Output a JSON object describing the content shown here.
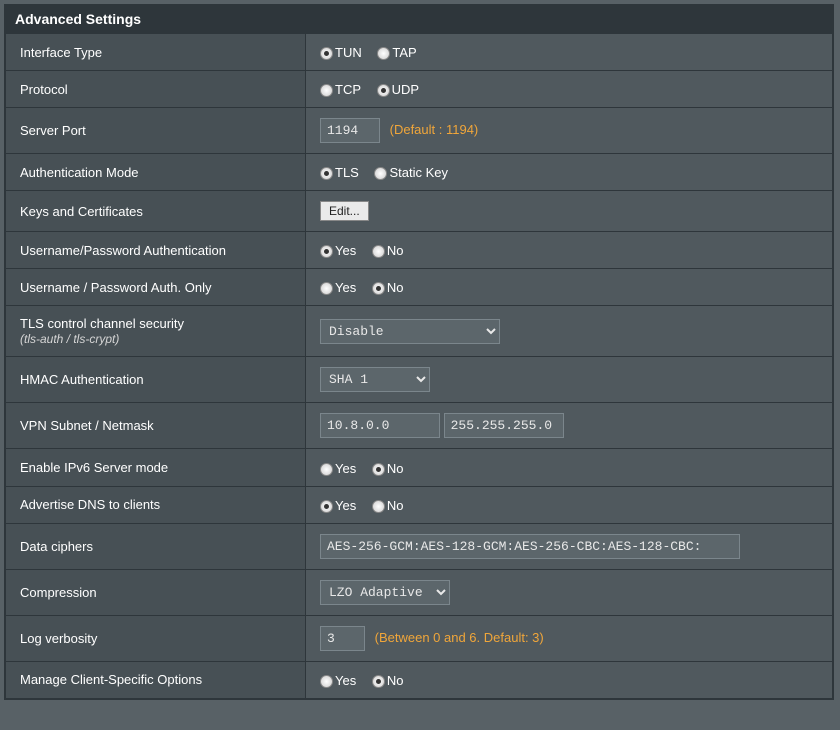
{
  "header": "Advanced Settings",
  "rows": {
    "interface_type": {
      "label": "Interface Type",
      "options": [
        "TUN",
        "TAP"
      ],
      "selected": "TUN"
    },
    "protocol": {
      "label": "Protocol",
      "options": [
        "TCP",
        "UDP"
      ],
      "selected": "UDP"
    },
    "server_port": {
      "label": "Server Port",
      "value": "1194",
      "hint": "(Default : 1194)"
    },
    "auth_mode": {
      "label": "Authentication Mode",
      "options": [
        "TLS",
        "Static Key"
      ],
      "selected": "TLS"
    },
    "keys_certs": {
      "label": "Keys and Certificates",
      "button": "Edit..."
    },
    "userpass_auth": {
      "label": "Username/Password Authentication",
      "options": [
        "Yes",
        "No"
      ],
      "selected": "Yes"
    },
    "userpass_only": {
      "label": "Username / Password Auth. Only",
      "options": [
        "Yes",
        "No"
      ],
      "selected": "No"
    },
    "tls_control": {
      "label": "TLS control channel security",
      "sublabel": "(tls-auth / tls-crypt)",
      "value": "Disable"
    },
    "hmac": {
      "label": "HMAC Authentication",
      "value": "SHA 1"
    },
    "vpn_subnet": {
      "label": "VPN Subnet / Netmask",
      "subnet": "10.8.0.0",
      "netmask": "255.255.255.0"
    },
    "ipv6": {
      "label": "Enable IPv6 Server mode",
      "options": [
        "Yes",
        "No"
      ],
      "selected": "No"
    },
    "advertise_dns": {
      "label": "Advertise DNS to clients",
      "options": [
        "Yes",
        "No"
      ],
      "selected": "Yes"
    },
    "data_ciphers": {
      "label": "Data ciphers",
      "value": "AES-256-GCM:AES-128-GCM:AES-256-CBC:AES-128-CBC:"
    },
    "compression": {
      "label": "Compression",
      "value": "LZO Adaptive"
    },
    "log_verbosity": {
      "label": "Log verbosity",
      "value": "3",
      "hint": "(Between 0 and 6. Default: 3)"
    },
    "client_specific": {
      "label": "Manage Client-Specific Options",
      "options": [
        "Yes",
        "No"
      ],
      "selected": "No"
    }
  }
}
